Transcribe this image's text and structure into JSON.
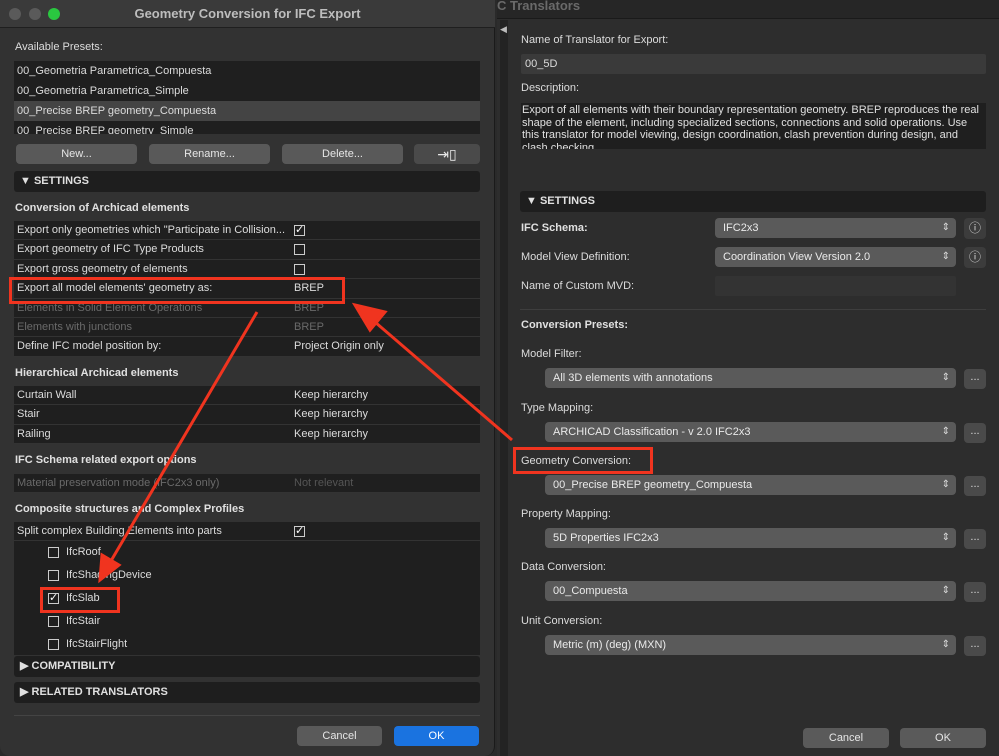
{
  "dialog": {
    "title": "Geometry Conversion for IFC Export",
    "presets_label": "Available Presets:",
    "presets": [
      "00_Geometria Parametrica_Compuesta",
      "00_Geometria Parametrica_Simple",
      "00_Precise BREP geometry_Compuesta",
      "00_Precise BREP geometry_Simple"
    ],
    "selected_preset": "00_Precise BREP geometry_Compuesta",
    "buttons": {
      "new": "New...",
      "rename": "Rename...",
      "delete": "Delete...",
      "import_icon": "import-file-icon"
    },
    "settings_header": "SETTINGS",
    "conversion_heading": "Conversion of Archicad elements",
    "conversion_rows": [
      {
        "label": "Export only geometries which \"Participate in Collision...",
        "checked": true
      },
      {
        "label": "Export geometry of IFC Type Products",
        "checked": false
      },
      {
        "label": "Export gross geometry of elements",
        "checked": false
      },
      {
        "label": "Export all model elements' geometry as:",
        "value": "BREP"
      },
      {
        "label": "Elements in Solid Element Operations",
        "value": "BREP",
        "disabled": true
      },
      {
        "label": "Elements with junctions",
        "value": "BREP",
        "disabled": true
      },
      {
        "label": "Define IFC model position by:",
        "value": "Project Origin only"
      }
    ],
    "hierarchical_heading": "Hierarchical Archicad elements",
    "hierarchical_rows": [
      {
        "label": "Curtain Wall",
        "value": "Keep hierarchy"
      },
      {
        "label": "Stair",
        "value": "Keep hierarchy"
      },
      {
        "label": "Railing",
        "value": "Keep hierarchy"
      }
    ],
    "schema_heading": "IFC Schema related export options",
    "schema_row": {
      "label": "Material preservation mode (IFC2x3 only)",
      "value": "Not relevant"
    },
    "composite_heading": "Composite structures and Complex Profiles",
    "split_label": "Split complex Building Elements into parts",
    "split_checked": true,
    "parts": [
      {
        "label": "IfcRoof",
        "checked": false
      },
      {
        "label": "IfcShadingDevice",
        "checked": false
      },
      {
        "label": "IfcSlab",
        "checked": true
      },
      {
        "label": "IfcStair",
        "checked": false
      },
      {
        "label": "IfcStairFlight",
        "checked": false
      }
    ],
    "compatibility": "COMPATIBILITY",
    "related": "RELATED TRANSLATORS",
    "cancel": "Cancel",
    "ok": "OK"
  },
  "translator": {
    "window_title": "C Translators",
    "name_label": "Name of Translator for Export:",
    "name_value": "00_5D",
    "description_label": "Description:",
    "description": "Export of all elements with their boundary representation geometry. BREP reproduces the real shape of the element, including specialized sections, connections and solid operations. Use this translator for model viewing, design coordination, clash prevention during design, and clash checking.",
    "settings_header": "SETTINGS",
    "ifc_schema_label": "IFC Schema:",
    "ifc_schema_value": "IFC2x3",
    "mvd_label": "Model View Definition:",
    "mvd_value": "Coordination View Version 2.0",
    "custom_mvd_label": "Name of Custom MVD:",
    "presets_heading": "Conversion Presets:",
    "model_filter_label": "Model Filter:",
    "model_filter_value": "All 3D elements with annotations",
    "type_mapping_label": "Type Mapping:",
    "type_mapping_value": "ARCHICAD Classification - v 2.0 IFC2x3",
    "geometry_label": "Geometry Conversion:",
    "geometry_value": "00_Precise BREP geometry_Compuesta",
    "property_label": "Property Mapping:",
    "property_value": "5D Properties IFC2x3",
    "data_label": "Data Conversion:",
    "data_value": "00_Compuesta",
    "unit_label": "Unit Conversion:",
    "unit_value": "Metric (m) (deg) (MXN)",
    "more": "...",
    "cancel": "Cancel",
    "ok": "OK"
  },
  "colors": {
    "annotation": "#f0341f",
    "ok_button": "#1a73e0",
    "accent_green": "#2ac840"
  }
}
